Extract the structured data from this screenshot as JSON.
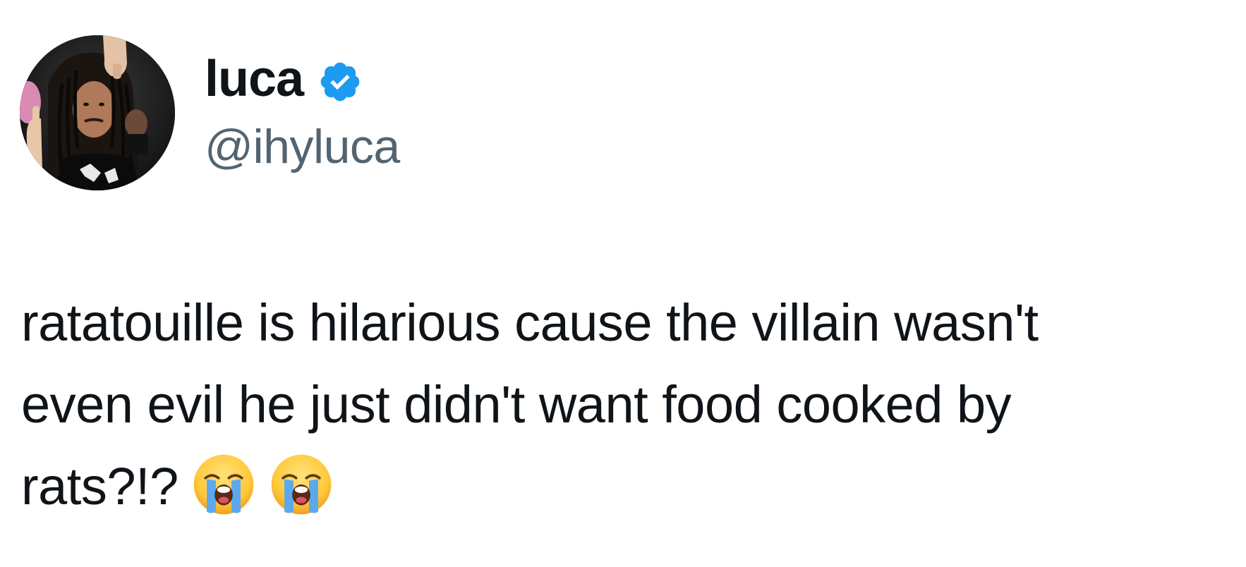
{
  "author": {
    "display_name": "luca",
    "handle": "@ihyluca",
    "verified": true,
    "verified_badge_color": "#1d9bf0",
    "avatar_icon": "profile-photo"
  },
  "tweet": {
    "lines": [
      "ratatouille is hilarious cause the villain wasn't",
      "even evil he just didn't want food cooked by",
      "rats?!?"
    ],
    "emojis": [
      "loudly-crying-face",
      "loudly-crying-face"
    ]
  },
  "colors": {
    "text_primary": "#0f1419",
    "text_secondary": "#536471",
    "background": "#ffffff"
  }
}
